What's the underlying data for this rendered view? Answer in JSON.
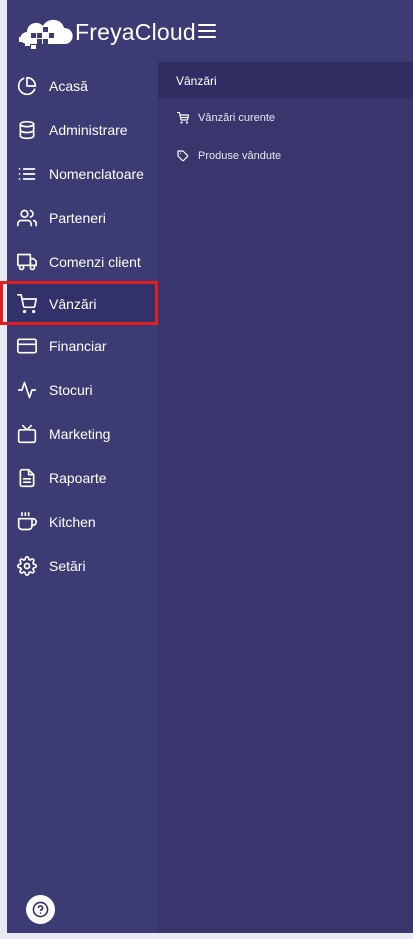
{
  "app": {
    "brand": "FreyaCloud",
    "colors": {
      "background": "#3d3b73",
      "submenu": "#38366c",
      "submenu_header": "#2f2d62",
      "highlight": "#e02020",
      "text": "#ffffff"
    }
  },
  "header": {
    "menu_icon": "hamburger-icon"
  },
  "sidebar": {
    "items": [
      {
        "label": "Acasă",
        "icon": "pie-chart-icon"
      },
      {
        "label": "Administrare",
        "icon": "database-icon"
      },
      {
        "label": "Nomenclatoare",
        "icon": "list-icon"
      },
      {
        "label": "Parteneri",
        "icon": "users-icon"
      },
      {
        "label": "Comenzi client",
        "icon": "truck-icon"
      },
      {
        "label": "Vânzări",
        "icon": "shopping-cart-icon",
        "active": true
      },
      {
        "label": "Financiar",
        "icon": "credit-card-icon"
      },
      {
        "label": "Stocuri",
        "icon": "activity-icon"
      },
      {
        "label": "Marketing",
        "icon": "tv-icon"
      },
      {
        "label": "Rapoarte",
        "icon": "file-text-icon"
      },
      {
        "label": "Kitchen",
        "icon": "coffee-cup-icon"
      },
      {
        "label": "Setări",
        "icon": "settings-icon"
      }
    ]
  },
  "submenu": {
    "title": "Vânzări",
    "items": [
      {
        "label": "Vânzări curente",
        "icon": "cart-icon"
      },
      {
        "label": "Produse vândute",
        "icon": "tag-icon"
      }
    ]
  },
  "footer": {
    "help_icon": "help-circle-icon"
  }
}
